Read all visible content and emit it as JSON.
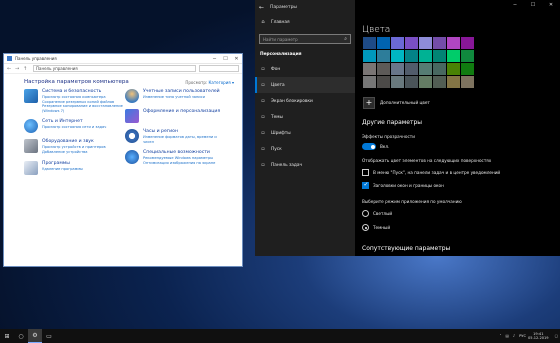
{
  "control_panel": {
    "title": "Панель управления",
    "address": "Панель управления",
    "heading": "Настройка параметров компьютера",
    "view_label": "Просмотр:",
    "view_value": "Категория ▾",
    "col1": [
      {
        "title": "Система и безопасность",
        "links": [
          "Просмотр состояния компьютера",
          "Сохранение резервных копий файлов",
          "Резервное копирование и восстановление (Windows 7)"
        ],
        "icon": "shield-flag-icon"
      },
      {
        "title": "Сеть и Интернет",
        "links": [
          "Просмотр состояния сети и задач"
        ],
        "icon": "globe-network-icon"
      },
      {
        "title": "Оборудование и звук",
        "links": [
          "Просмотр устройств и принтеров",
          "Добавление устройства"
        ],
        "icon": "printer-icon"
      },
      {
        "title": "Программы",
        "links": [
          "Удаление программы"
        ],
        "icon": "programs-icon"
      }
    ],
    "col2": [
      {
        "title": "Учетные записи пользователей",
        "links": [
          "Изменение типа учетной записи"
        ],
        "icon": "users-icon"
      },
      {
        "title": "Оформление и персонализация",
        "links": [],
        "icon": "appearance-icon"
      },
      {
        "title": "Часы и регион",
        "links": [
          "Изменение форматов даты, времени и чисел"
        ],
        "icon": "clock-icon"
      },
      {
        "title": "Специальные возможности",
        "links": [
          "Рекомендуемые Windows параметры",
          "Оптимизация изображения на экране"
        ],
        "icon": "accessibility-icon"
      }
    ]
  },
  "settings": {
    "title": "Параметры",
    "home": "Главная",
    "search_placeholder": "Найти параметр",
    "section": "Персонализация",
    "nav": [
      {
        "label": "Фон",
        "icon": "image-icon"
      },
      {
        "label": "Цвета",
        "icon": "palette-icon"
      },
      {
        "label": "Экран блокировки",
        "icon": "lock-screen-icon"
      },
      {
        "label": "Темы",
        "icon": "brush-icon"
      },
      {
        "label": "Шрифты",
        "icon": "font-icon"
      },
      {
        "label": "Пуск",
        "icon": "start-icon"
      },
      {
        "label": "Панель задач",
        "icon": "taskbar-icon"
      }
    ],
    "active_index": 1,
    "page_title": "Цвета",
    "swatches": [
      "#1e4b87",
      "#0063b1",
      "#6b69d6",
      "#7a4fc4",
      "#8e8cd8",
      "#744da9",
      "#b146c2",
      "#881798",
      "#0099bc",
      "#2d7d9a",
      "#00b7c3",
      "#038387",
      "#00b294",
      "#018574",
      "#00cc6a",
      "#10893e",
      "#7a7574",
      "#5d5a58",
      "#68768a",
      "#515c6b",
      "#567c73",
      "#486860",
      "#498205",
      "#107c10",
      "#767676",
      "#4c4a48",
      "#69797e",
      "#4a5459",
      "#647c64",
      "#525e54",
      "#847545",
      "#7e735f"
    ],
    "custom_color": "Дополнительный цвет",
    "other_heading": "Другие параметры",
    "transparency_label": "Эффекты прозрачности",
    "transparency_value": "Вкл.",
    "accent_surfaces_label": "Отображать цвет элементов на следующих поверхностях",
    "accent_start": "В меню \"Пуск\", на панели задач и в центре уведомлений",
    "accent_titlebars": "Заголовки окон и границы окон",
    "mode_label": "Выберите режим приложения по умолчанию",
    "mode_light": "Светлый",
    "mode_dark": "Темный",
    "related": "Сопутствующие параметры"
  },
  "taskbar": {
    "lang": "РУС",
    "time": "19:41",
    "date": "05.12.2019"
  }
}
